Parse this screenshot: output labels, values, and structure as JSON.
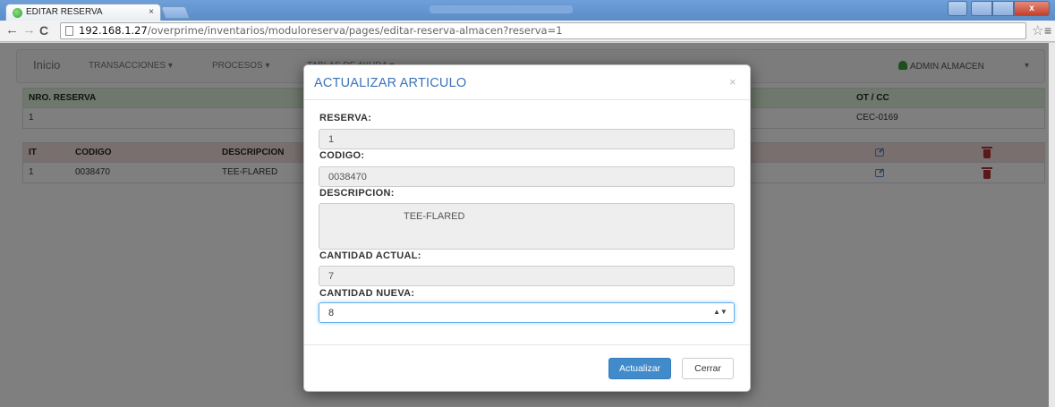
{
  "browser": {
    "tab_title": "EDITAR RESERVA",
    "tab_close": "×",
    "url_host": "192.168.1.27",
    "url_path": "/overprime/inventarios/moduloreserva/pages/editar-reserva-almacen?reserva=1",
    "back_glyph": "←",
    "forward_glyph": "→",
    "reload_glyph": "C",
    "star_glyph": "☆",
    "menu_glyph": "≡"
  },
  "nav": {
    "home": "Inicio",
    "transactions": "TRANSACCIONES ▾",
    "processes": "PROCESOS ▾",
    "help_tables": "TABLAS DE AYUDA ▾",
    "user": "ADMIN ALMACEN",
    "caret": "▾"
  },
  "reservation_table": {
    "headers": [
      "NRO. RESERVA",
      "OT / CC"
    ],
    "row": [
      "1",
      "CEC-0169"
    ]
  },
  "items_table": {
    "headers": [
      "IT",
      "CODIGO",
      "DESCRIPCION"
    ],
    "rows": [
      {
        "it": "1",
        "code": "0038470",
        "description": "TEE-FLARED"
      }
    ]
  },
  "modal": {
    "title": "ACTUALIZAR ARTICULO",
    "close": "×",
    "labels": {
      "reserve": "RESERVA:",
      "code": "CODIGO:",
      "description": "DESCRIPCION:",
      "current_qty": "CANTIDAD ACTUAL:",
      "new_qty": "CANTIDAD NUEVA:"
    },
    "values": {
      "reserve": "1",
      "code": "0038470",
      "description": "TEE-FLARED",
      "current_qty": "7",
      "new_qty": "8"
    },
    "spinner": "▲▼",
    "buttons": {
      "update": "Actualizar",
      "close": "Cerrar"
    }
  },
  "colors": {
    "primary": "#428bca",
    "title_blue": "#3a73b8",
    "success_bg": "#dff0d8",
    "danger_bg": "#f2dede"
  }
}
